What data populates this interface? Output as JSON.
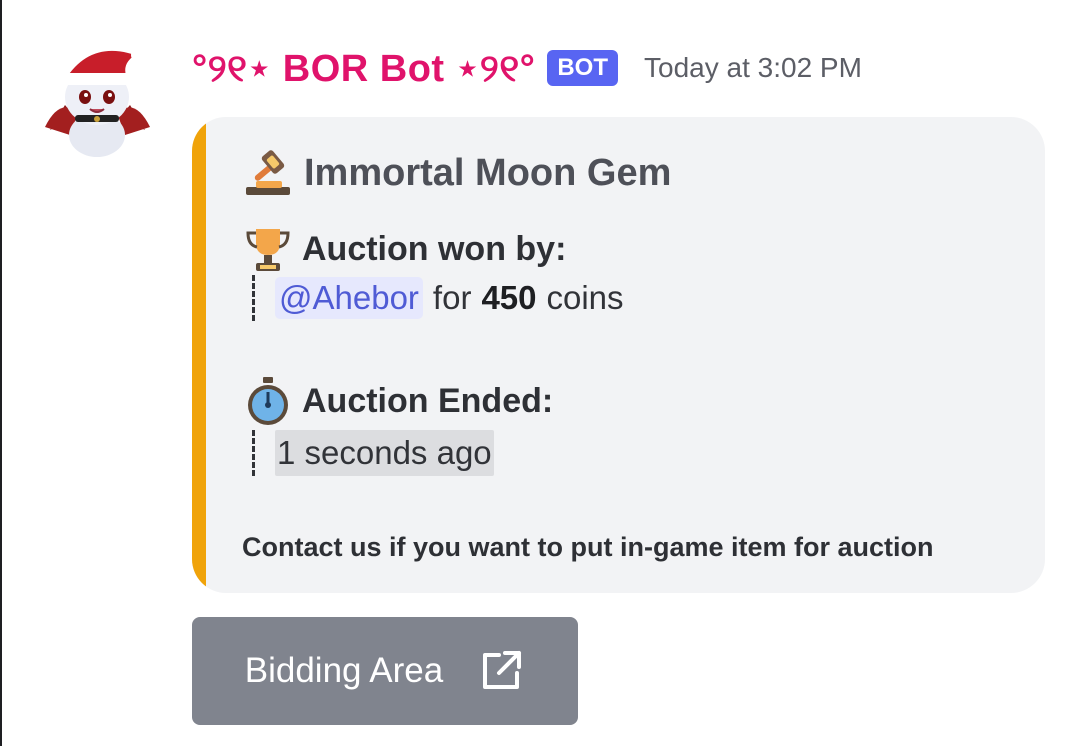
{
  "message": {
    "author": "°୨୧⋆ BOR Bot ⋆୨୧°",
    "bot_tag": "BOT",
    "timestamp": "Today at 3:02 PM"
  },
  "embed": {
    "accent_color": "#f0a30a",
    "title_icon": "gavel-icon",
    "title": "Immortal Moon Gem",
    "won_field": {
      "icon": "trophy-icon",
      "name": "Auction won by:",
      "mention": "@Ahebor",
      "connector": "for",
      "amount": "450",
      "unit": "coins"
    },
    "ended_field": {
      "icon": "stopwatch-icon",
      "name": "Auction Ended:",
      "value": "1 seconds ago"
    },
    "footer": "Contact us if you want to put in-game item for auction"
  },
  "button": {
    "label": "Bidding Area",
    "icon": "external-link-icon"
  }
}
